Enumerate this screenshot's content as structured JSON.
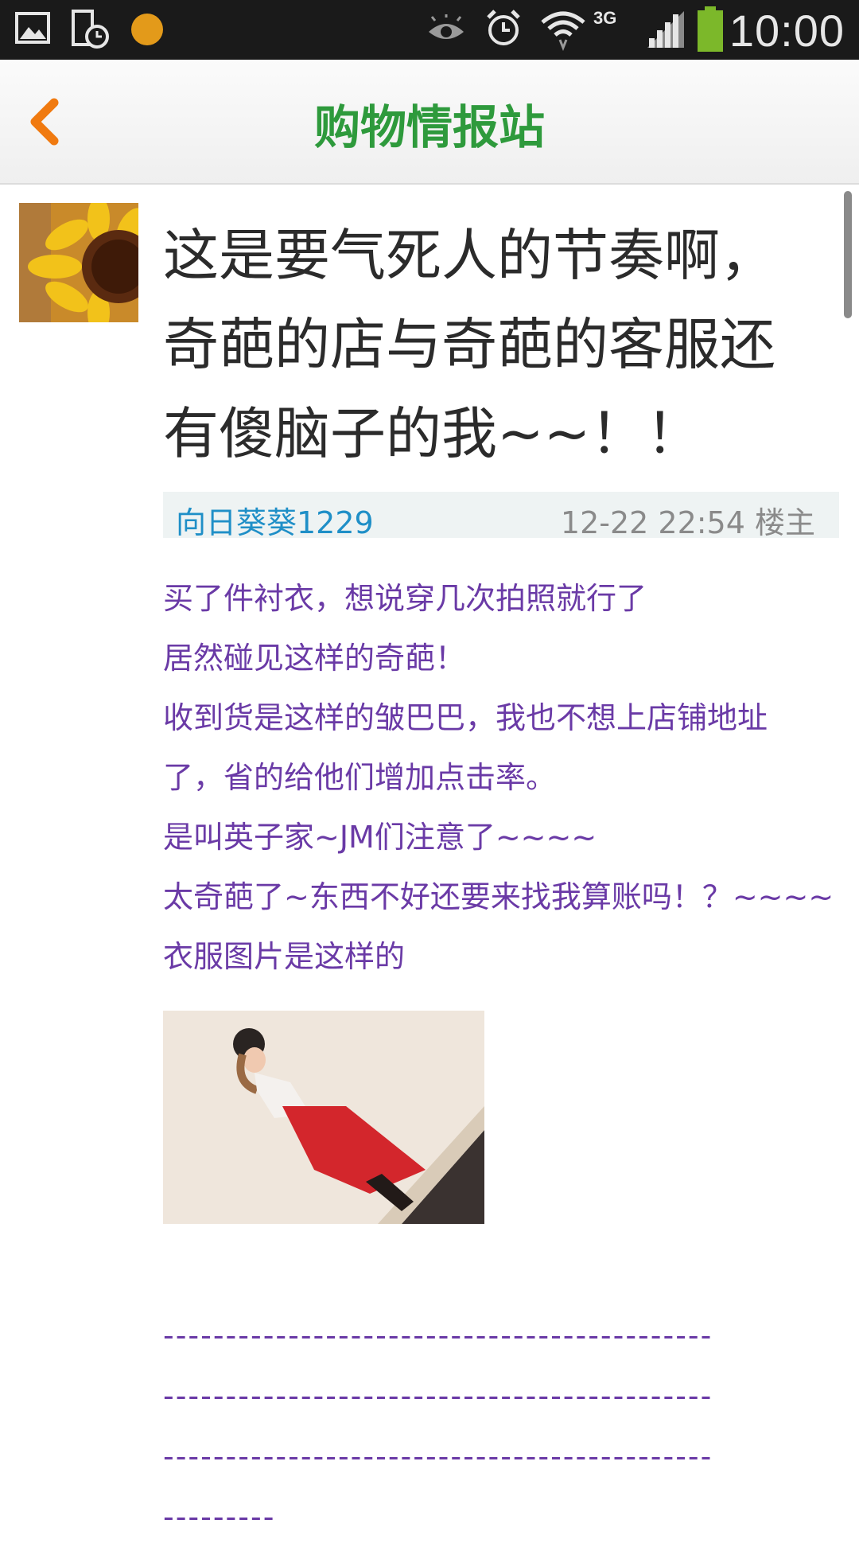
{
  "statusbar": {
    "time": "10:00",
    "network": "3G",
    "icons": [
      "image-icon",
      "phone-clock-icon",
      "orange-circle-icon",
      "eye-icon",
      "alarm-icon",
      "wifi-icon",
      "signal-icon",
      "battery-icon"
    ]
  },
  "header": {
    "title": "购物情报站",
    "back_icon": "chevron-left-icon",
    "accent_color": "#2e9a3c",
    "back_color": "#f07a10"
  },
  "post": {
    "title_lines": [
      "这是要气死人的节奏啊，",
      "奇葩的店与奇葩的客服还",
      "有傻脑子的我~~！！"
    ],
    "author": "向日葵葵1229",
    "time": "12-22 22:54 楼主",
    "body_lines": [
      "买了件衬衣，想说穿几次拍照就行了",
      "居然碰见这样的奇葩！",
      "收到货是这样的皱巴巴，我也不想上店铺地址",
      "了，省的给他们增加点击率。",
      "是叫英子家~JM们注意了~~~~",
      "太奇葩了~东西不好还要来找我算账吗！？~~~~",
      "衣服图片是这样的"
    ],
    "dash_lines": [
      "--------------------------------------------",
      "--------------------------------------------",
      "--------------------------------------------",
      "---------"
    ],
    "text_color": "#6a3aa6",
    "author_color": "#1f8fc7"
  }
}
